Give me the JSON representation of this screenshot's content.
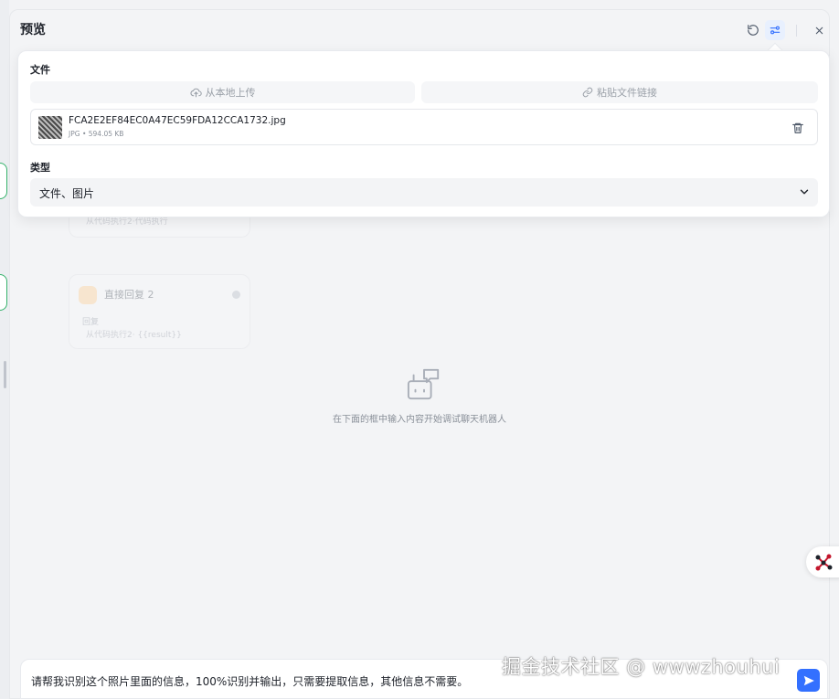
{
  "header": {
    "title": "预览",
    "reset_icon": "rotate-ccw-icon",
    "settings_icon": "sliders-icon",
    "close_icon": "close-icon"
  },
  "file_section": {
    "label": "文件",
    "upload_local": "从本地上传",
    "paste_link": "粘贴文件链接",
    "file": {
      "name": "FCA2E2EF84EC0A47EC59FDA12CCA1732.jpg",
      "type": "JPG",
      "separator": "•",
      "size": "594.05 KB"
    }
  },
  "type_section": {
    "label": "类型",
    "selected": "文件、图片"
  },
  "background_cards": [
    {
      "sub2": "从代码执行2·代码执行"
    },
    {
      "title": "直接回复 2",
      "sub1": "回复",
      "sub2": "从代码执行2· {{result}}"
    }
  ],
  "empty_state": {
    "text": "在下面的框中输入内容开始调试聊天机器人"
  },
  "chat_input": {
    "value": "请帮我识别这个照片里面的信息，100%识别并输出，只需要提取信息，其他信息不需要。",
    "send_icon": "send-icon"
  },
  "watermark": "掘金技术社区 @ wwwzhouhui",
  "colors": {
    "accent": "#3370ff",
    "node_border": "#35b26b",
    "panel_bg": "#f3f4f6"
  }
}
